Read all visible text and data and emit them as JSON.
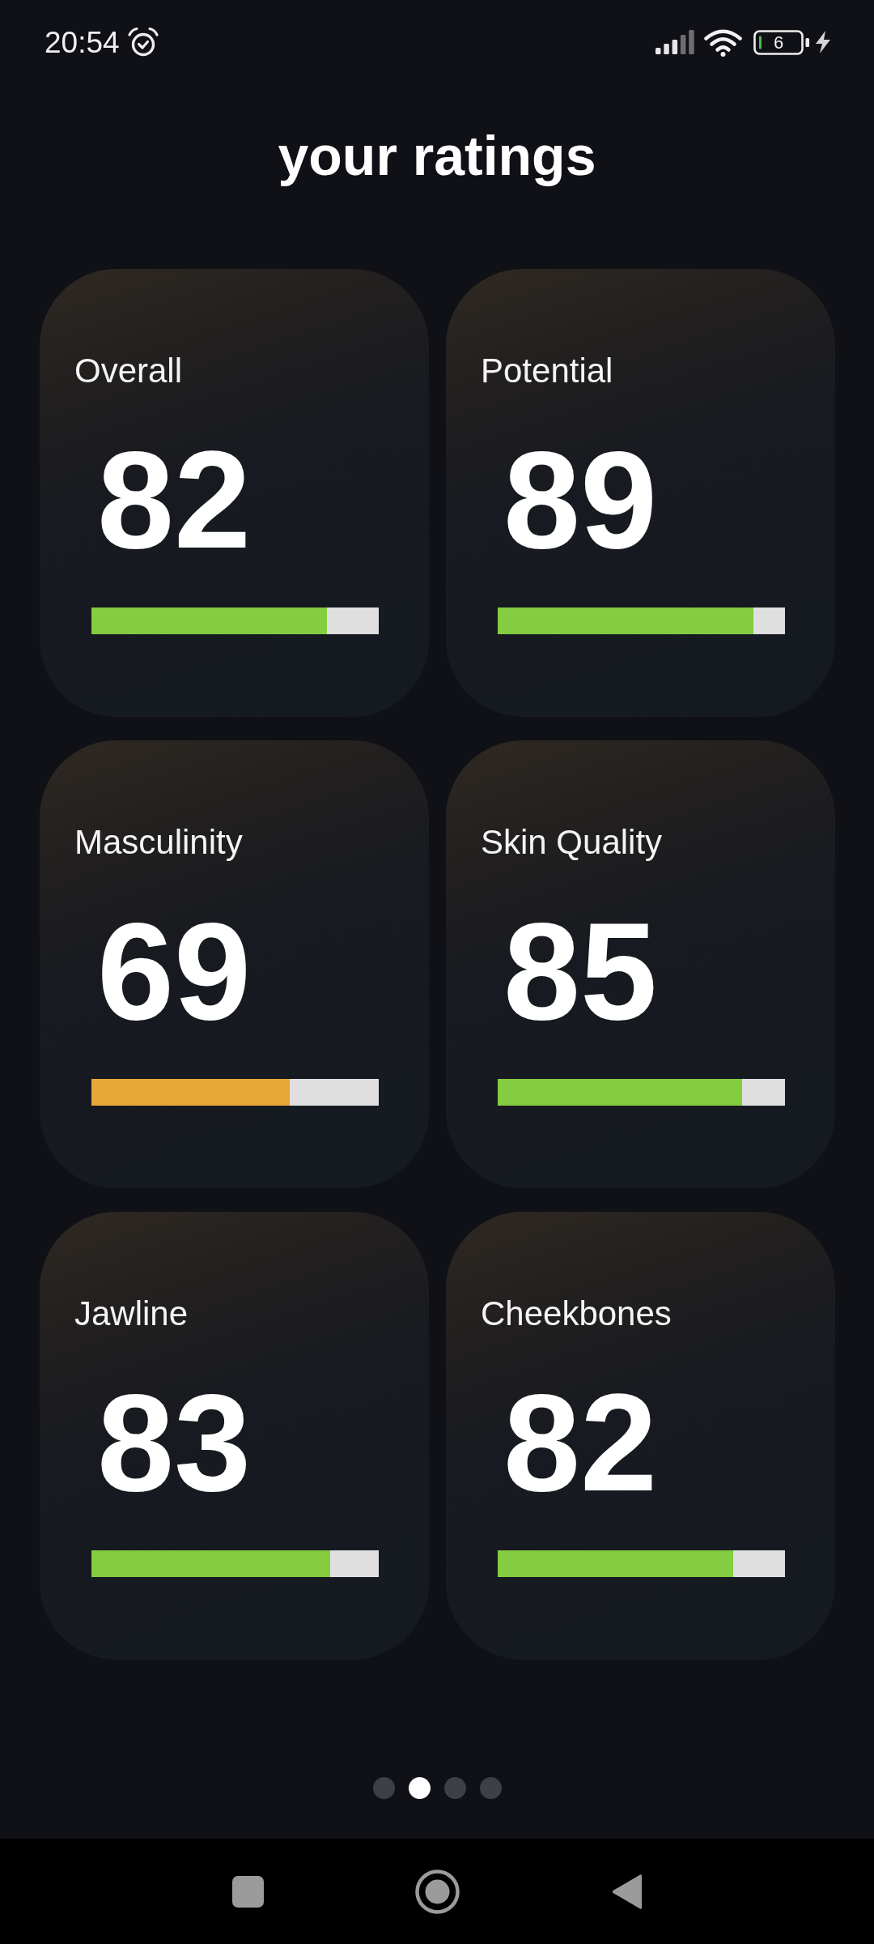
{
  "status_bar": {
    "time": "20:54",
    "battery": "6"
  },
  "title": "your ratings",
  "ratings": [
    {
      "label": "Overall",
      "score": "82",
      "level": 0.82,
      "color": "#84cc40"
    },
    {
      "label": "Potential",
      "score": "89",
      "level": 0.89,
      "color": "#84cc40"
    },
    {
      "label": "Masculinity",
      "score": "69",
      "level": 0.69,
      "color": "#e8a838"
    },
    {
      "label": "Skin Quality",
      "score": "85",
      "level": 0.85,
      "color": "#84cc40"
    },
    {
      "label": "Jawline",
      "score": "83",
      "level": 0.83,
      "color": "#84cc40"
    },
    {
      "label": "Cheekbones",
      "score": "82",
      "level": 0.82,
      "color": "#84cc40"
    }
  ],
  "pager": [
    {
      "selected": false
    },
    {
      "selected": true
    },
    {
      "selected": false
    },
    {
      "selected": false
    }
  ]
}
